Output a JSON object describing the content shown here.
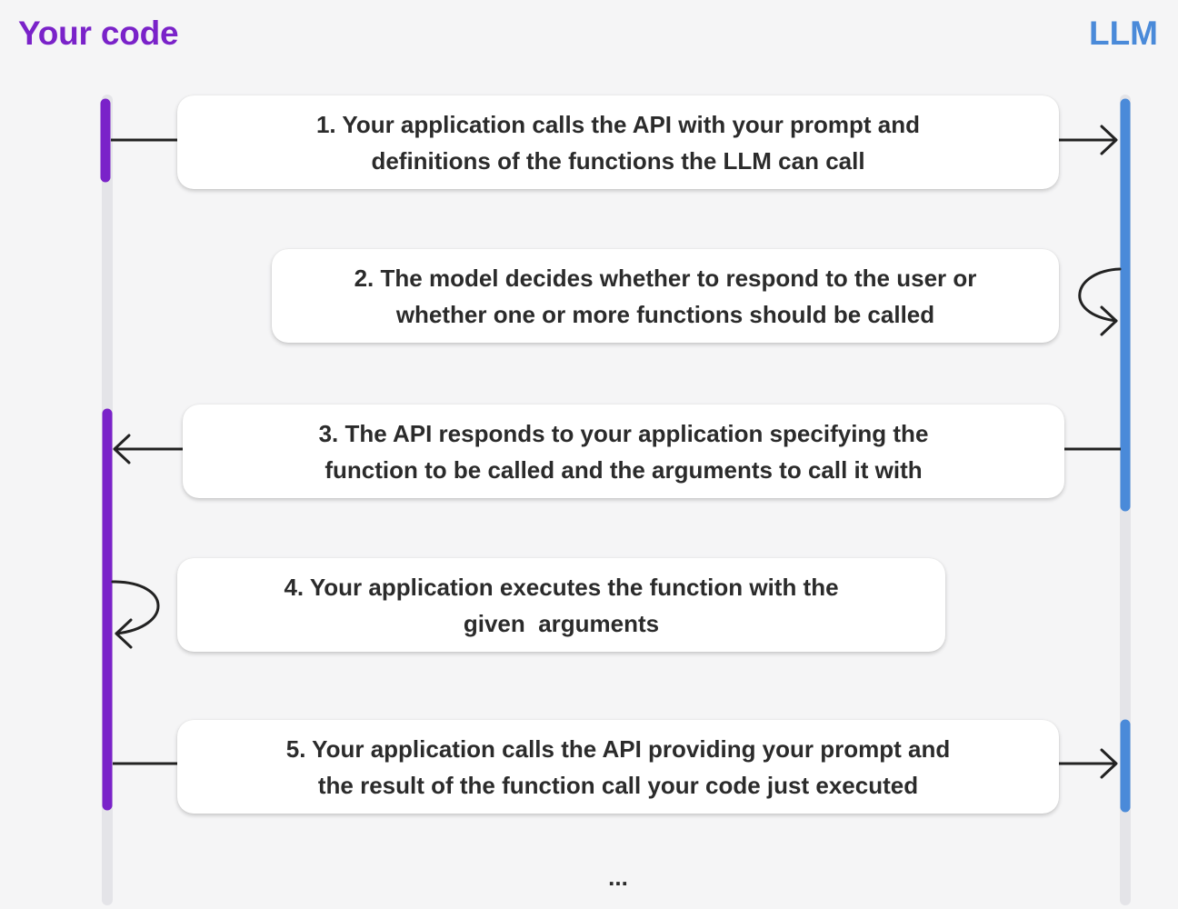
{
  "header": {
    "left_title": "Your code",
    "right_title": "LLM"
  },
  "steps": [
    {
      "line1": "1. Your application calls the API with your prompt and",
      "line2": "definitions of the functions the LLM can call"
    },
    {
      "line1": "2. The model decides whether to respond to the user or",
      "line2": "whether one or more functions should be called"
    },
    {
      "line1": "3. The API responds to your application specifying the",
      "line2": "function to be called and the arguments to call it with"
    },
    {
      "line1": "4. Your application executes the function with the",
      "line2": "given  arguments"
    },
    {
      "line1": "5. Your application calls the API providing your prompt and",
      "line2": "the result of the function call your code just executed"
    }
  ],
  "footer": {
    "ellipsis": "..."
  },
  "colors": {
    "your_code": "#7a22c9",
    "llm": "#4a8ad9",
    "track": "#e4e4e8",
    "arrow": "#222222"
  }
}
